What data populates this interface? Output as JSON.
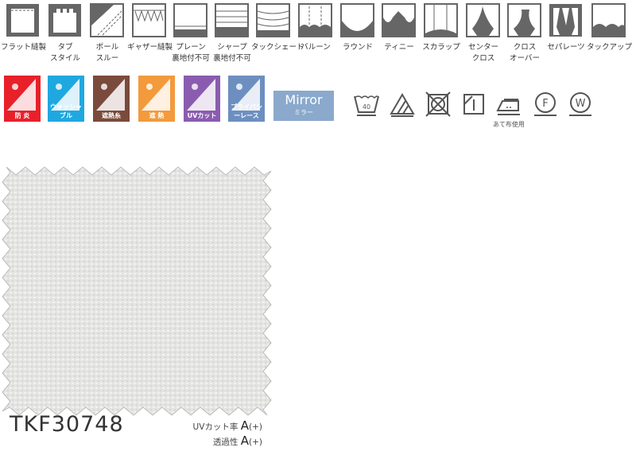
{
  "styles": [
    {
      "icon": "flat-sewing-icon",
      "label": [
        "フラット縫製"
      ]
    },
    {
      "icon": "tab-style-icon",
      "label": [
        "タブ",
        "スタイル"
      ]
    },
    {
      "icon": "pole-through-icon",
      "label": [
        "ポール",
        "スルー"
      ]
    },
    {
      "icon": "gather-sewing-icon",
      "label": [
        "ギャザー縫製"
      ]
    },
    {
      "icon": "plain-shade-icon",
      "label": [
        "プレーン",
        "裏地付不可"
      ]
    },
    {
      "icon": "sharp-shade-icon",
      "label": [
        "シャープ",
        "裏地付不可"
      ]
    },
    {
      "icon": "tuck-shade-icon",
      "label": [
        "タックシェード"
      ]
    },
    {
      "icon": "balloon-icon",
      "label": [
        "バルーン"
      ]
    },
    {
      "icon": "round-icon",
      "label": [
        "ラウンド"
      ]
    },
    {
      "icon": "tinny-icon",
      "label": [
        "ティニー"
      ]
    },
    {
      "icon": "scallop-icon",
      "label": [
        "スカラップ"
      ]
    },
    {
      "icon": "center-cross-icon",
      "label": [
        "センター",
        "クロス"
      ]
    },
    {
      "icon": "cross-over-icon",
      "label": [
        "クロス",
        "オーバー"
      ]
    },
    {
      "icon": "separates-icon",
      "label": [
        "セパレーツ"
      ]
    },
    {
      "icon": "tuck-up-icon",
      "label": [
        "タックアップ"
      ]
    }
  ],
  "badges": [
    {
      "icon": "flame-retardant-icon",
      "label": "防 炎",
      "color": "#e8202a"
    },
    {
      "icon": "washable-icon",
      "label": "ウォッシャブル",
      "color": "#1fa8e0"
    },
    {
      "icon": "heat-shield-yarn-icon",
      "label": "遮熱糸",
      "color": "#7a4a3c"
    },
    {
      "icon": "heat-shield-icon",
      "label": "遮 熱",
      "color": "#f39a3c"
    },
    {
      "icon": "uv-cut-icon",
      "label": "UVカット",
      "color": "#8a5cb0"
    },
    {
      "icon": "privacy-lace-icon",
      "label": "プライバシーレース",
      "color": "#6d8fc0"
    }
  ],
  "mirror": {
    "label": "Mirror",
    "sub": "ミラー",
    "color": "#8aa9cc"
  },
  "care": {
    "wash_temp": "40",
    "iron_note": "あて布使用",
    "icons": [
      "wash-40-icon",
      "bleach-icon",
      "no-tumble-dry-icon",
      "drip-dry-icon",
      "iron-low-icon",
      "dry-clean-f-icon",
      "wet-clean-w-icon"
    ],
    "f": "F",
    "w": "W"
  },
  "product": {
    "code": "TKF30748",
    "uv_label": "UVカット率",
    "uv_value": "A",
    "uv_suffix": "(+)",
    "trans_label": "透過性",
    "trans_value": "A",
    "trans_suffix": "(+)"
  }
}
